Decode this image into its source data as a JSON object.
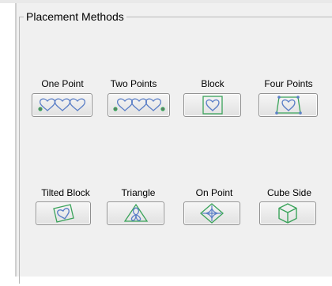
{
  "group": {
    "title": "Placement Methods"
  },
  "methods": [
    {
      "label": "One Point",
      "icon": "one-point-hearts-icon"
    },
    {
      "label": "Two Points",
      "icon": "two-points-hearts-icon"
    },
    {
      "label": "Block",
      "icon": "block-heart-icon"
    },
    {
      "label": "Four Points",
      "icon": "four-points-heart-icon"
    },
    {
      "label": "Tilted Block",
      "icon": "tilted-block-heart-icon"
    },
    {
      "label": "Triangle",
      "icon": "triangle-icon"
    },
    {
      "label": "On Point",
      "icon": "on-point-icon"
    },
    {
      "label": "Cube Side",
      "icon": "cube-side-icon"
    }
  ],
  "colors": {
    "icon_blue": "#5b7fc7",
    "icon_green": "#3aa35a",
    "point_gray": "#6e6e6e"
  }
}
